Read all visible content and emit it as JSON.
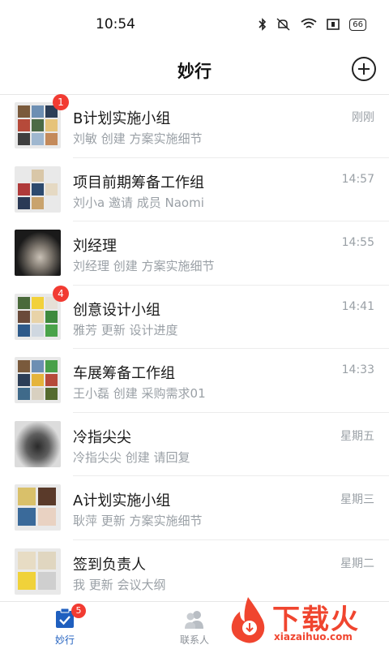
{
  "status": {
    "time": "10:54",
    "battery": "66"
  },
  "header": {
    "title": "妙行"
  },
  "conversations": [
    {
      "name": "B计划实施小组",
      "sub": "刘敏 创建 方案实施细节",
      "time": "刚刚",
      "badge": "1"
    },
    {
      "name": "项目前期筹备工作组",
      "sub": "刘小a 邀请 成员 Naomi",
      "time": "14:57",
      "badge": ""
    },
    {
      "name": "刘经理",
      "sub": "刘经理 创建 方案实施细节",
      "time": "14:55",
      "badge": ""
    },
    {
      "name": "创意设计小组",
      "sub": "雅芳 更新 设计进度",
      "time": "14:41",
      "badge": "4"
    },
    {
      "name": "车展筹备工作组",
      "sub": "王小磊 创建 采购需求01",
      "time": "14:33",
      "badge": ""
    },
    {
      "name": "冷指尖尖",
      "sub": "冷指尖尖 创建 请回复",
      "time": "星期五",
      "badge": ""
    },
    {
      "name": "A计划实施小组",
      "sub": "耿萍 更新 方案实施细节",
      "time": "星期三",
      "badge": ""
    },
    {
      "name": "签到负责人",
      "sub": "我 更新 会议大纲",
      "time": "星期二",
      "badge": ""
    }
  ],
  "tabs": {
    "miaoxing": {
      "label": "妙行",
      "badge": "5",
      "color": "#1f5fbf"
    },
    "contacts": {
      "label": "联系人",
      "color": "#8a8f96"
    }
  },
  "watermark": {
    "text": "下载火",
    "url": "xiazaihuo.com"
  },
  "colors": {
    "badge": "#f23b32",
    "accent": "#1f5fbf"
  }
}
